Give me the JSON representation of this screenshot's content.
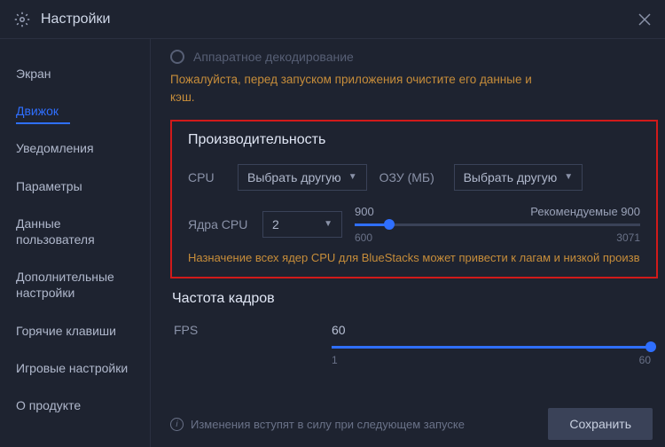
{
  "header": {
    "title": "Настройки"
  },
  "sidebar": {
    "items": [
      {
        "label": "Экран"
      },
      {
        "label": "Движок"
      },
      {
        "label": "Уведомления"
      },
      {
        "label": "Параметры"
      },
      {
        "label": "Данные пользователя"
      },
      {
        "label": "Дополнительные настройки"
      },
      {
        "label": "Горячие клавиши"
      },
      {
        "label": "Игровые настройки"
      },
      {
        "label": "О продукте"
      }
    ],
    "active_index": 1
  },
  "decoding": {
    "hw_label": "Аппаратное декодирование",
    "warn": "Пожалуйста, перед запуском приложения очистите его данные и кэш."
  },
  "performance": {
    "title": "Производительность",
    "cpu_label": "CPU",
    "cpu_select": "Выбрать другую",
    "ram_label": "ОЗУ (МБ)",
    "ram_select": "Выбрать другую",
    "cores_label": "Ядра CPU",
    "cores_select": "2",
    "ram_value": "900",
    "ram_recommended": "Рекомендуемые 900",
    "ram_min": "600",
    "ram_max": "3071",
    "ram_percent": 12,
    "warn": "Назначение всех ядер CPU для BlueStacks может привести к лагам и низкой произво"
  },
  "framerate": {
    "title": "Частота кадров",
    "fps_label": "FPS",
    "fps_value": "60",
    "fps_min": "1",
    "fps_max": "60",
    "fps_percent": 100
  },
  "footer": {
    "info": "Изменения вступят в силу при следующем запуске",
    "save": "Сохранить"
  }
}
